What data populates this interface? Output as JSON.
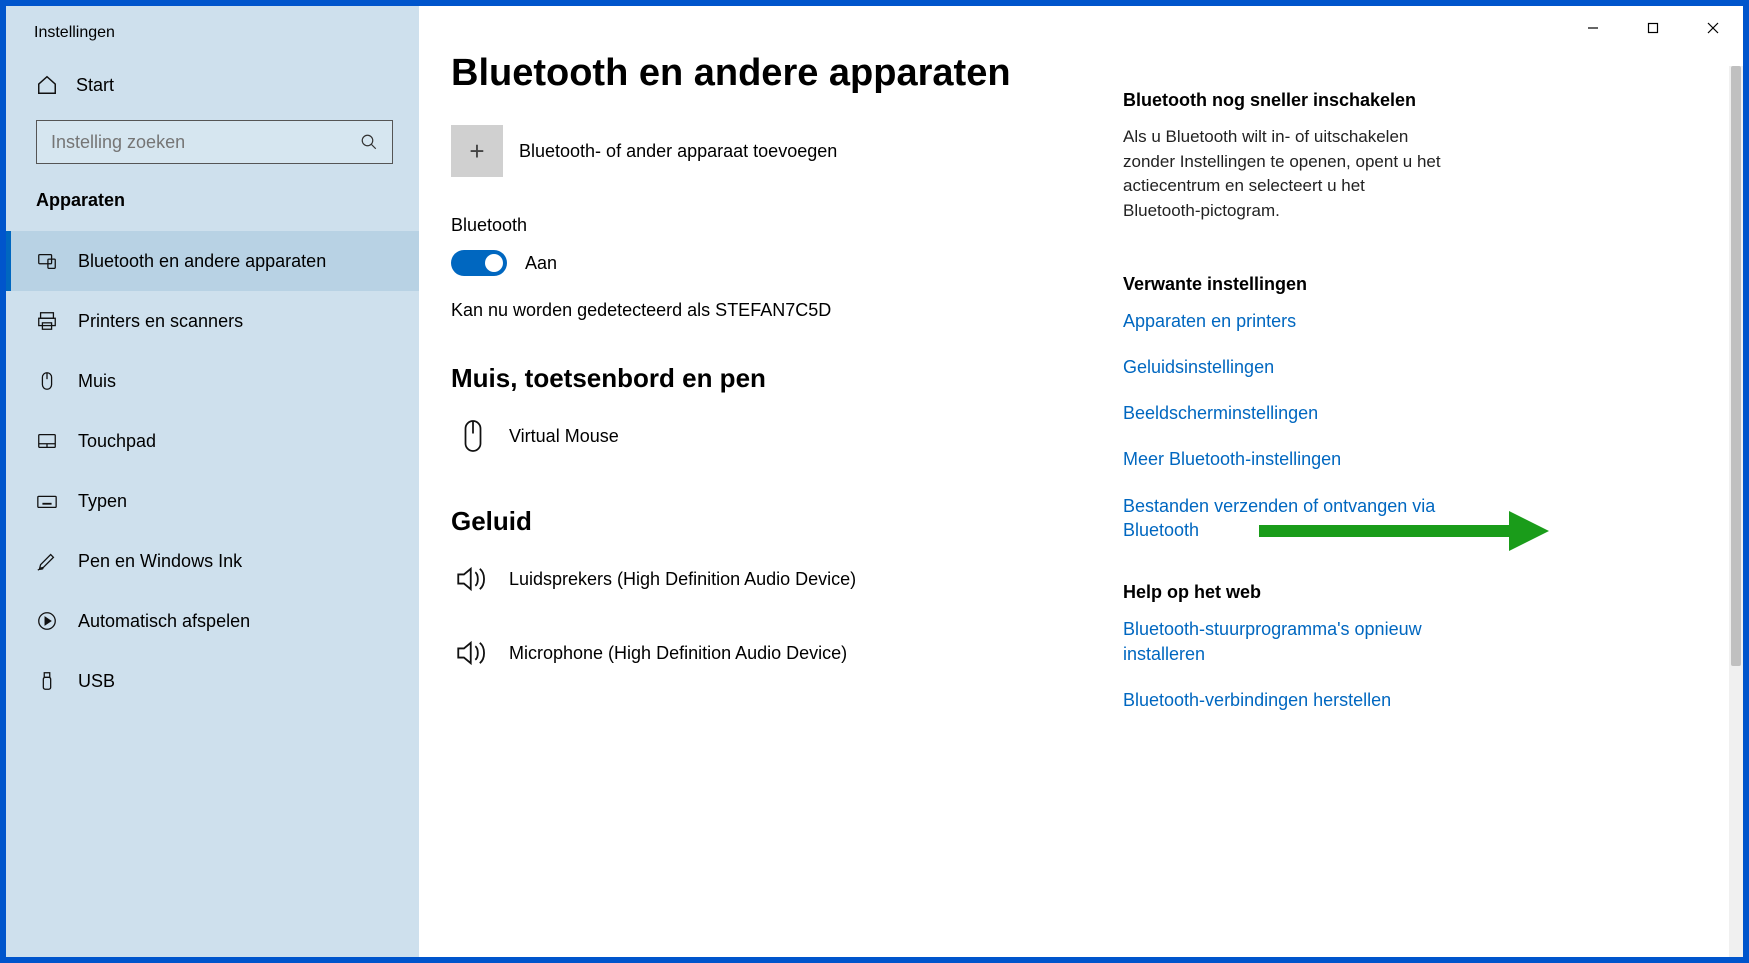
{
  "app_title": "Instellingen",
  "home_label": "Start",
  "search_placeholder": "Instelling zoeken",
  "section": "Apparaten",
  "nav": [
    {
      "label": "Bluetooth en andere apparaten"
    },
    {
      "label": "Printers en scanners"
    },
    {
      "label": "Muis"
    },
    {
      "label": "Touchpad"
    },
    {
      "label": "Typen"
    },
    {
      "label": "Pen en Windows Ink"
    },
    {
      "label": "Automatisch afspelen"
    },
    {
      "label": "USB"
    }
  ],
  "page_title": "Bluetooth en andere apparaten",
  "add_device_label": "Bluetooth- of ander apparaat toevoegen",
  "bt_heading": "Bluetooth",
  "bt_toggle_label": "Aan",
  "discover_text": "Kan nu worden gedetecteerd als STEFAN7C5D",
  "group_mouse_title": "Muis, toetsenbord en pen",
  "device_mouse": "Virtual Mouse",
  "group_audio_title": "Geluid",
  "device_speakers": "Luidsprekers (High Definition Audio Device)",
  "device_microphone": "Microphone (High Definition Audio Device)",
  "right": {
    "heading1": "Bluetooth nog sneller inschakelen",
    "text1": "Als u Bluetooth wilt in- of uitschakelen zonder Instellingen te openen, opent u het actiecentrum en selecteert u het Bluetooth-pictogram.",
    "heading2": "Verwante instellingen",
    "links": [
      "Apparaten en printers",
      "Geluidsinstellingen",
      "Beeldscherminstellingen",
      "Meer Bluetooth-instellingen",
      "Bestanden verzenden of ontvangen via Bluetooth"
    ],
    "heading3": "Help op het web",
    "help_links": [
      "Bluetooth-stuurprogramma's opnieuw installeren",
      "Bluetooth-verbindingen herstellen"
    ]
  }
}
